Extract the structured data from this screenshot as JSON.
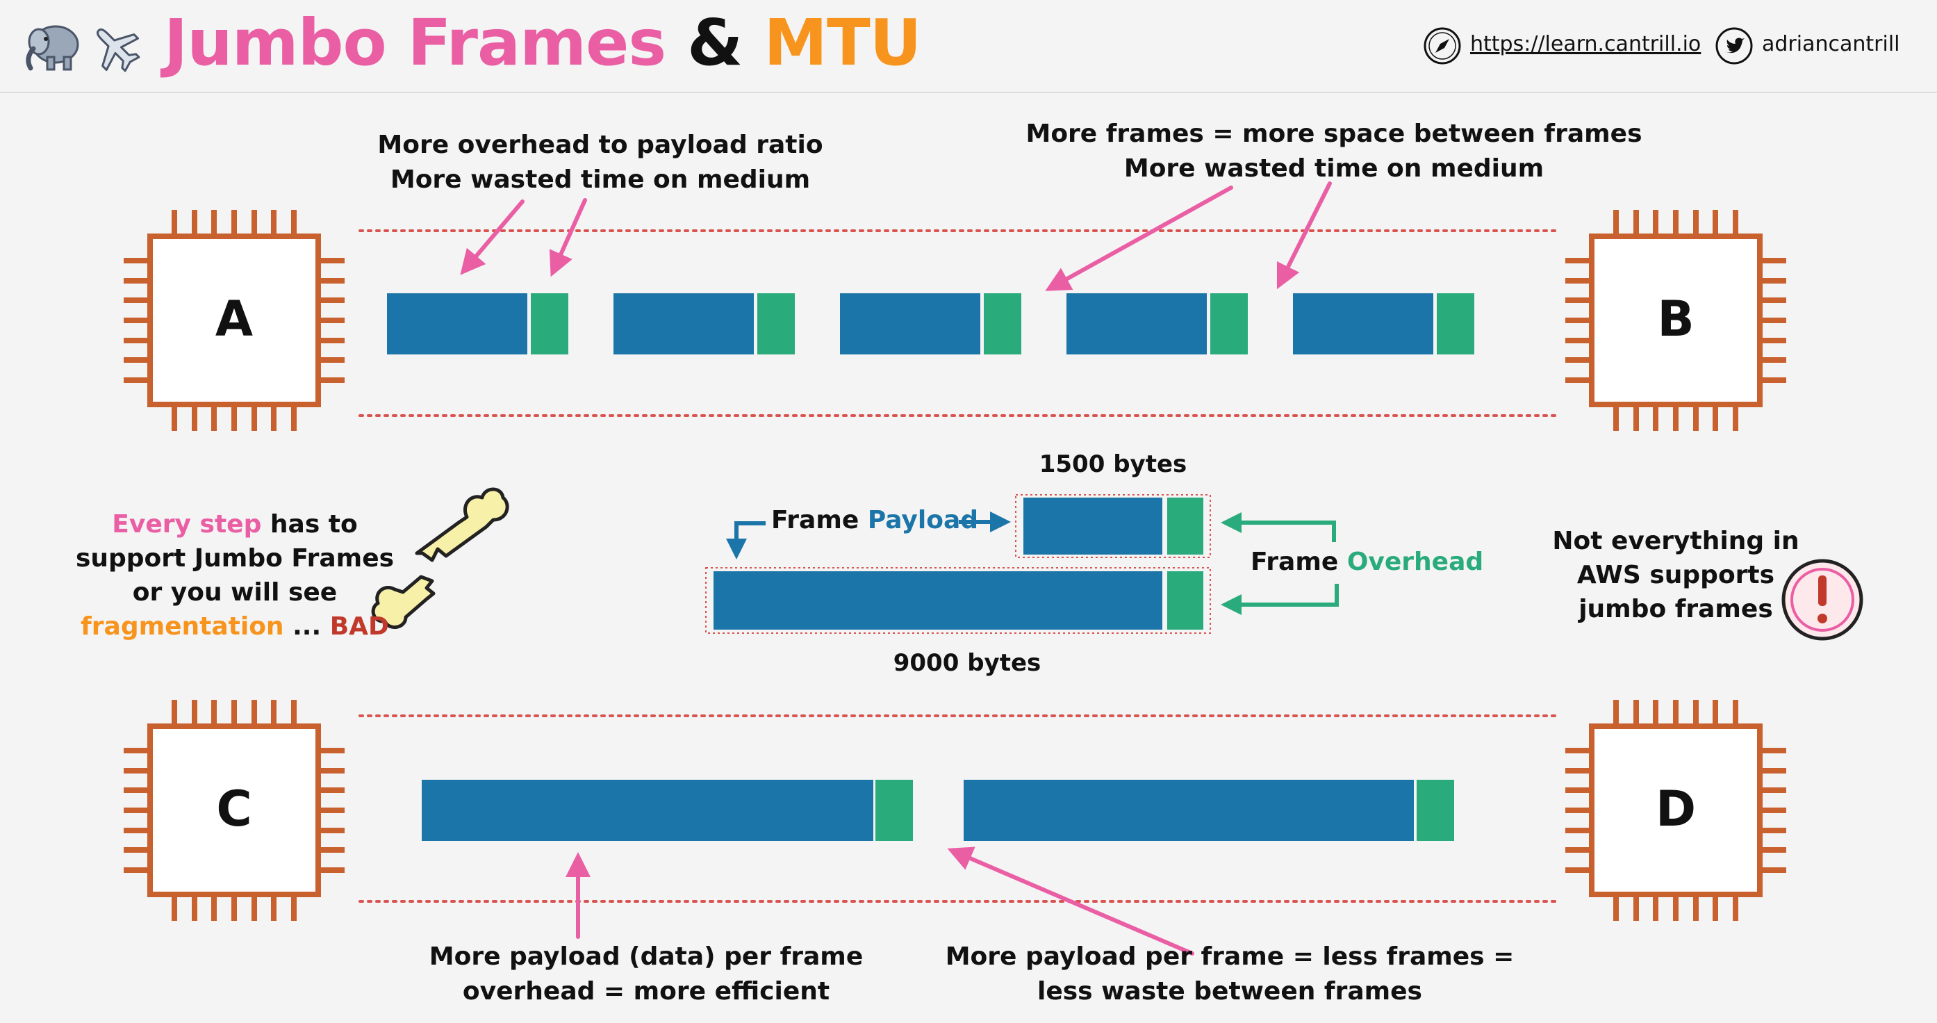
{
  "header": {
    "title_part1": "Jumbo Frames",
    "title_part2": "&",
    "title_part3": "MTU",
    "url_text": "https://learn.cantrill.io",
    "twitter_handle": "adriancantrill",
    "icons": [
      "elephant-icon",
      "airplane-icon",
      "compass-icon",
      "twitter-icon"
    ]
  },
  "hosts": {
    "a": "A",
    "b": "B",
    "c": "C",
    "d": "D"
  },
  "annotations": {
    "top_left_line1": "More overhead to payload ratio",
    "top_left_line2": "More wasted time on medium",
    "top_right_line1": "More frames = more space between frames",
    "top_right_line2": "More wasted time on medium",
    "bottom_left_line1": "More payload (data) per frame",
    "bottom_left_line2": "overhead = more efficient",
    "bottom_right_line1": "More payload per frame = less frames =",
    "bottom_right_line2": "less waste between frames"
  },
  "frame_legend": {
    "label_1500": "1500 bytes",
    "label_9000": "9000 bytes",
    "payload_prefix": "Frame",
    "payload_word": "Payload",
    "overhead_prefix": "Frame",
    "overhead_word": "Overhead"
  },
  "left_note": {
    "line1_highlight": "Every step",
    "line1_rest": "has to",
    "line2": "support Jumbo Frames",
    "line3": "or you will see",
    "line4_highlight": "fragmentation",
    "line4_mid": "...",
    "line4_bad": "BAD"
  },
  "right_note": {
    "line1": "Not everything in",
    "line2": "AWS supports",
    "line3": "jumbo frames",
    "icon": "exclamation-icon"
  },
  "colors": {
    "pink": "#ea5ea4",
    "orange": "#f7941d",
    "blue": "#1b75a8",
    "green": "#2aab7c",
    "chip": "#c8612e",
    "red_dotted": "#d9534f",
    "bad_red": "#c0392b"
  }
}
